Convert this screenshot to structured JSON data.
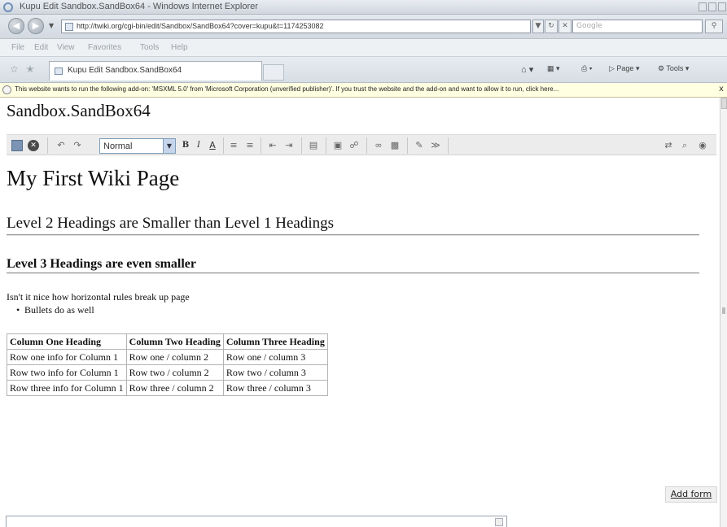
{
  "browser": {
    "window_title": "Kupu Edit Sandbox.SandBox64 - Windows Internet Explorer",
    "address": "http://twiki.org/cgi-bin/edit/Sandbox/SandBox64?cover=kupu&t=1174253082",
    "search_placeholder": "Google",
    "menu": [
      "File",
      "Edit",
      "View",
      "Favorites",
      "Tools",
      "Help"
    ],
    "tab_label": "Kupu Edit Sandbox.SandBox64",
    "commands": {
      "page": "Page",
      "tools": "Tools"
    },
    "infobar_text": "This website wants to run the following add-on: 'MSXML 5.0' from 'Microsoft Corporation (unverified publisher)'. If you trust the website and the add-on and want to allow it to run, click here...",
    "infobar_close": "x"
  },
  "page": {
    "heading": "Sandbox.SandBox64"
  },
  "toolbar": {
    "style_value": "Normal",
    "bold": "B",
    "italic": "I",
    "underline": "A"
  },
  "content": {
    "h1": "My First Wiki Page",
    "h2": "Level 2 Headings are Smaller than Level 1 Headings",
    "h3": "Level 3 Headings are even smaller",
    "paragraph": "Isn't it nice how horizontal rules break up page",
    "bullet": "Bullets do as well",
    "table": {
      "headers": [
        "Column One Heading",
        "Column Two Heading",
        "Column Three Heading"
      ],
      "rows": [
        [
          "Row one info for Column 1",
          "Row one / column 2",
          "Row one / column 3"
        ],
        [
          "Row two info for Column 1",
          "Row two / column 2",
          "Row two / column 3"
        ],
        [
          "Row three info for Column 1",
          "Row three / column 2",
          "Row three / column 3"
        ]
      ]
    }
  },
  "footer": {
    "add_form": "Add form"
  }
}
